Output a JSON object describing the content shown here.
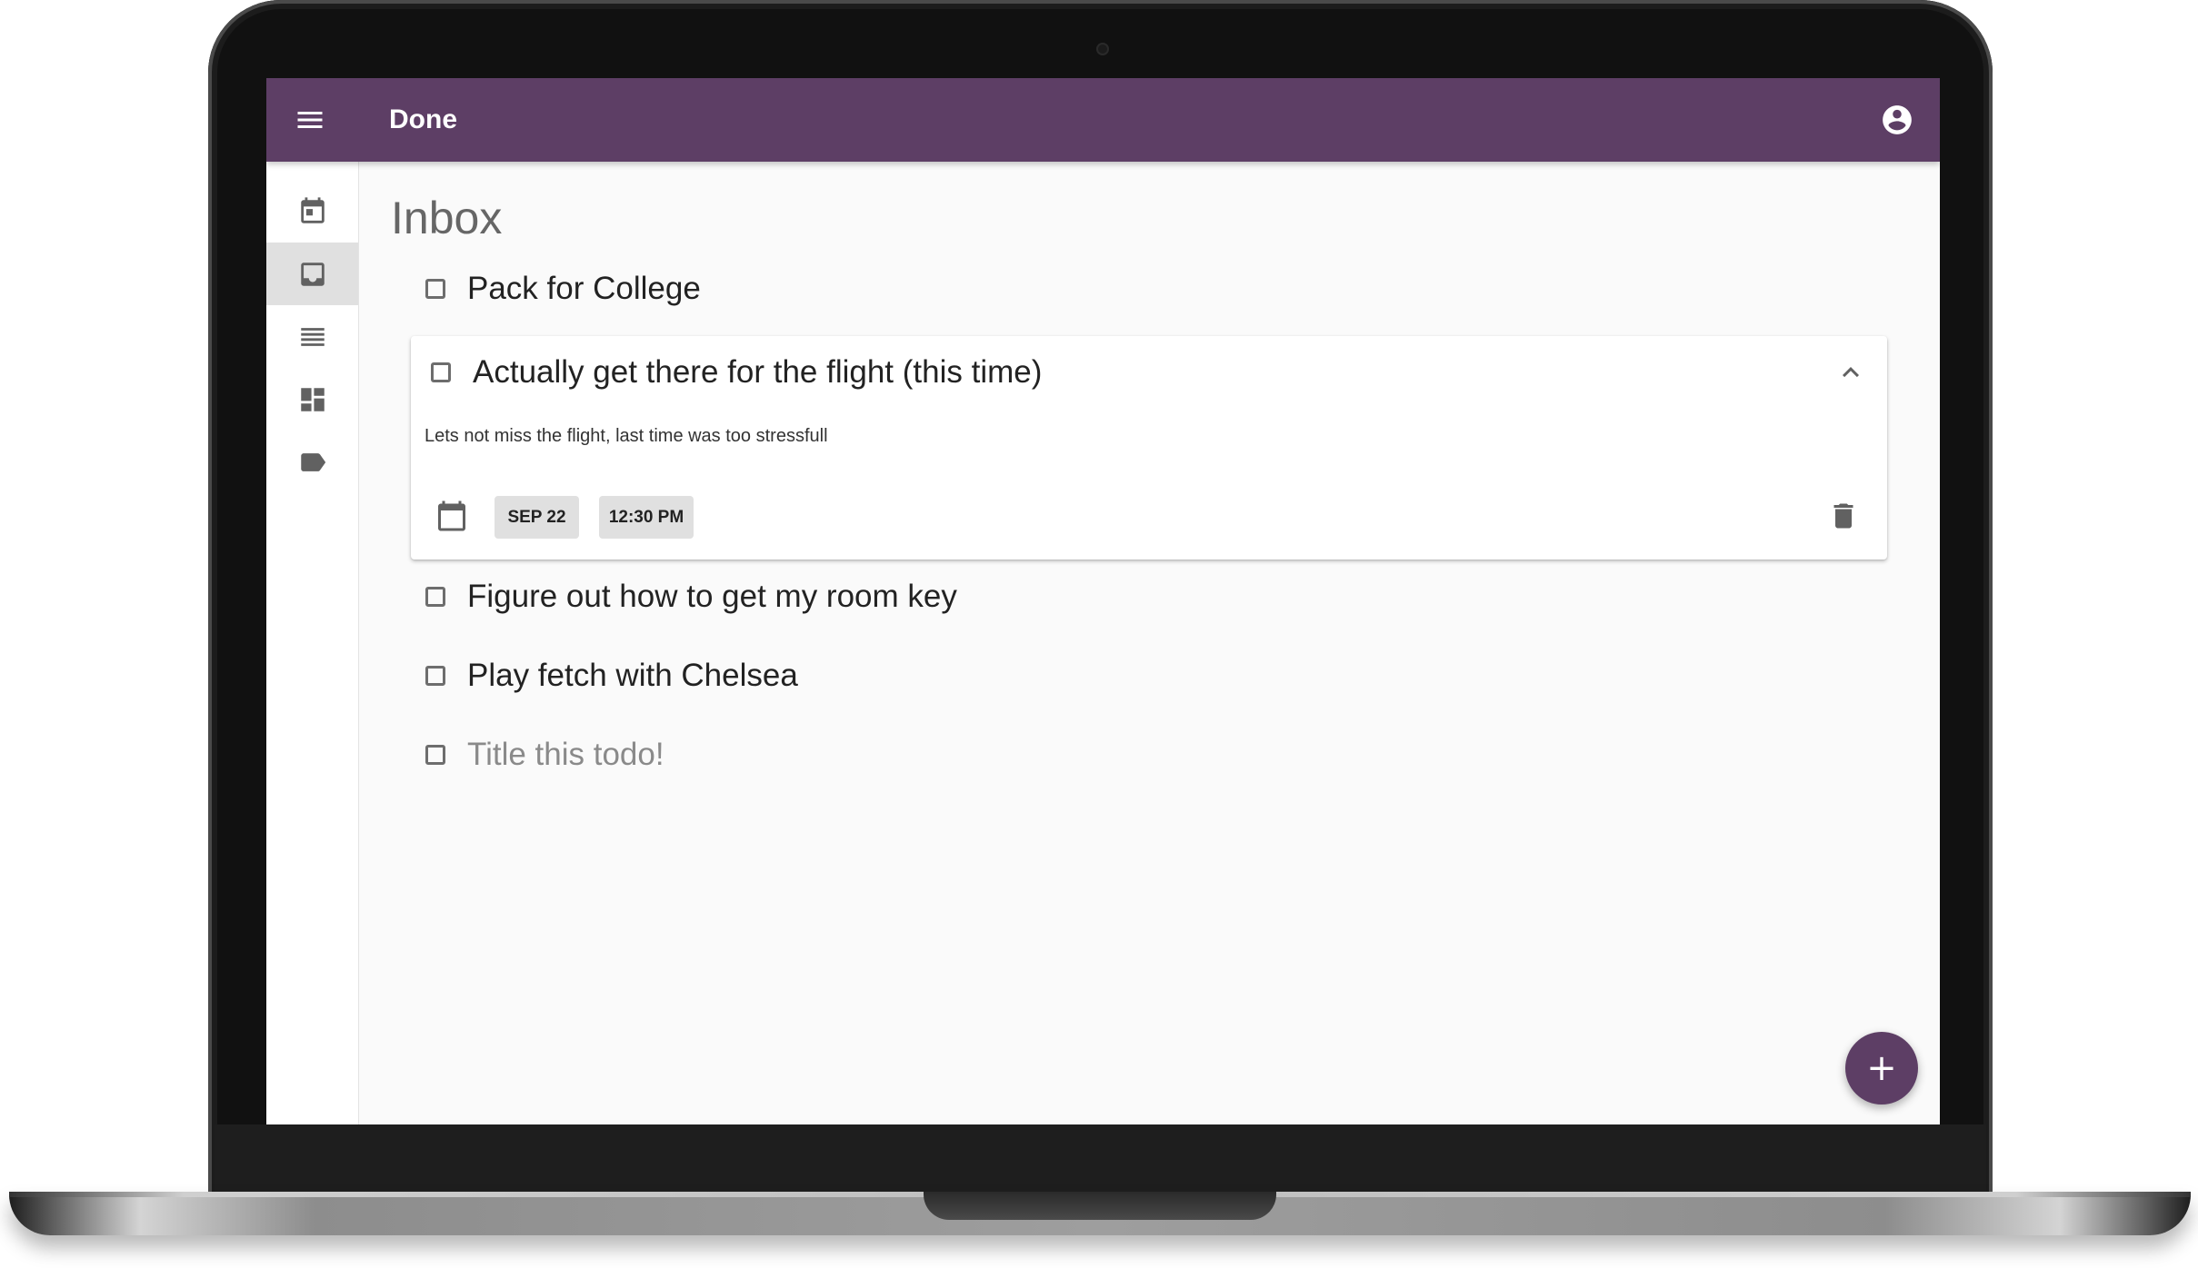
{
  "app": {
    "title": "Done"
  },
  "sidebar": {
    "items": [
      {
        "icon": "calendar-today-icon",
        "active": false
      },
      {
        "icon": "inbox-icon",
        "active": true
      },
      {
        "icon": "list-icon",
        "active": false
      },
      {
        "icon": "dashboard-icon",
        "active": false
      },
      {
        "icon": "label-icon",
        "active": false
      }
    ]
  },
  "main": {
    "title": "Inbox",
    "todos": [
      {
        "title": "Pack for College",
        "done": false
      },
      {
        "title": "Actually get there for the flight (this time)",
        "done": false,
        "expanded": true,
        "notes": "Lets not miss the flight, last time was too stressfull",
        "date": "SEP 22",
        "time": "12:30 PM"
      },
      {
        "title": "Figure out how to get my room key",
        "done": false
      },
      {
        "title": "Play fetch with Chelsea",
        "done": false
      }
    ],
    "new_todo_placeholder": "Title this todo!"
  },
  "fab": {
    "label": "+"
  },
  "colors": {
    "primary": "#5d3e65",
    "background": "#fafafa",
    "chip": "#e0e0e0"
  }
}
